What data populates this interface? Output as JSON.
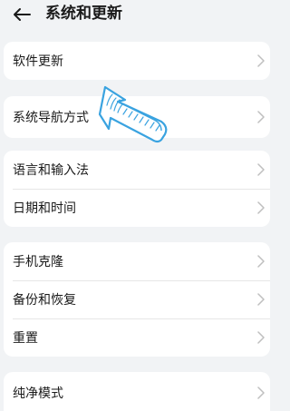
{
  "header": {
    "title": "系统和更新",
    "back_icon": "arrow-left-icon"
  },
  "groups": [
    {
      "items": [
        {
          "label": "软件更新"
        }
      ]
    },
    {
      "items": [
        {
          "label": "系统导航方式"
        }
      ]
    },
    {
      "items": [
        {
          "label": "语言和输入法"
        },
        {
          "label": "日期和时间"
        }
      ]
    },
    {
      "items": [
        {
          "label": "手机克隆"
        },
        {
          "label": "备份和恢复"
        },
        {
          "label": "重置"
        }
      ]
    },
    {
      "items": [
        {
          "label": "纯净模式"
        }
      ]
    }
  ],
  "colors": {
    "background": "#f1f3f5",
    "card": "#ffffff",
    "chevron": "#bfbfbf",
    "annotation_stroke": "#3aa3e0"
  },
  "icons": {
    "chevron": "chevron-right-icon",
    "annotation": "pointer-arrow-annotation"
  }
}
